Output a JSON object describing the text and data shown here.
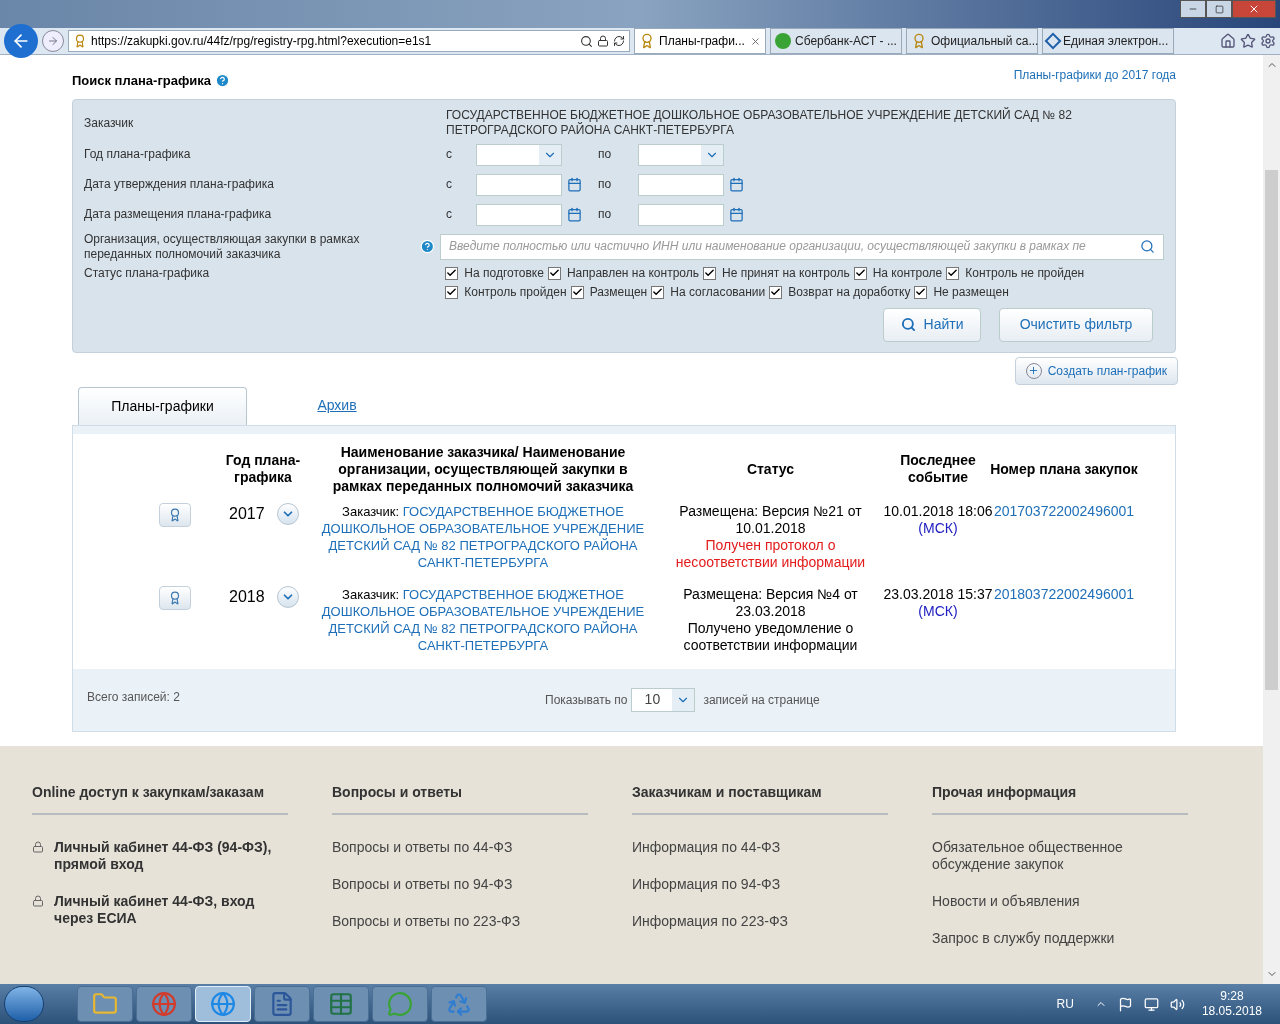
{
  "browser": {
    "url": "https://zakupki.gov.ru/44fz/rpg/registry-rpg.html?execution=e1s1",
    "tabs": [
      {
        "title": "Планы-графи...",
        "selected": true,
        "kind": "emblem"
      },
      {
        "title": "Сбербанк-АСТ - ...",
        "selected": false,
        "kind": "sber"
      },
      {
        "title": "Официальный са...",
        "selected": false,
        "kind": "emblem"
      },
      {
        "title": "Единая электрон...",
        "selected": false,
        "kind": "diamond"
      }
    ]
  },
  "search": {
    "title": "Поиск плана-графика",
    "old_link": "Планы-графики до 2017 года",
    "customer_label": "Заказчик",
    "customer_value": "ГОСУДАРСТВЕННОЕ БЮДЖЕТНОЕ ДОШКОЛЬНОЕ ОБРАЗОВАТЕЛЬНОЕ УЧРЕЖДЕНИЕ ДЕТСКИЙ САД № 82 ПЕТРОГРАДСКОГО РАЙОНА САНКТ-ПЕТЕРБУРГА",
    "ranges": [
      {
        "label": "Год плана-графика",
        "from": "с",
        "to": "по",
        "kind": "select"
      },
      {
        "label": "Дата утверждения плана-графика",
        "from": "с",
        "to": "по",
        "kind": "date"
      },
      {
        "label": "Дата размещения плана-графика",
        "from": "с",
        "to": "по",
        "kind": "date"
      }
    ],
    "org_label": "Организация, осуществляющая закупки в рамках переданных полномочий заказчика",
    "org_placeholder": "Введите полностью или частично ИНН или наименование организации, осуществляющей закупки в рамках пе",
    "status_label": "Статус плана-графика",
    "statuses": [
      {
        "label": "На подготовке",
        "checked": true
      },
      {
        "label": "Направлен на контроль",
        "checked": true
      },
      {
        "label": "Не принят на контроль",
        "checked": true
      },
      {
        "label": "На контроле",
        "checked": true
      },
      {
        "label": "Контроль не пройден",
        "checked": true
      },
      {
        "label": "Контроль пройден",
        "checked": true
      },
      {
        "label": "Размещен",
        "checked": true
      },
      {
        "label": "На согласовании",
        "checked": true
      },
      {
        "label": "Возврат на доработку",
        "checked": true
      },
      {
        "label": "Не размещен",
        "checked": true
      }
    ],
    "find_button": "Найти",
    "clear_button": "Очистить фильтр"
  },
  "create_button": "Создать план-график",
  "tabs": [
    {
      "label": "Планы-графики",
      "selected": true
    },
    {
      "label": "Архив",
      "selected": false
    }
  ],
  "table": {
    "columns": [
      "Год плана-графика",
      "Наименование заказчика/ Наименование организации, осуществляющей закупки в рамках переданных полномочий заказчика",
      "Статус",
      "Последнее событие",
      "Номер плана закупок"
    ],
    "rows": [
      {
        "year": "2017",
        "customer_prefix": "Заказчик:",
        "customer": "ГОСУДАРСТВЕННОЕ БЮДЖЕТНОЕ ДОШКОЛЬНОЕ ОБРАЗОВАТЕЛЬНОЕ УЧРЕЖДЕНИЕ ДЕТСКИЙ САД № 82 ПЕТРОГРАДСКОГО РАЙОНА САНКТ-ПЕТЕРБУРГА",
        "status": "Размещена: Версия №21 от 10.01.2018",
        "note": "Получен протокол о несоответствии информации",
        "note_alert": true,
        "event": "10.01.2018 18:06",
        "tz": "(МСК)",
        "number": "201703722002496001"
      },
      {
        "year": "2018",
        "customer_prefix": "Заказчик:",
        "customer": "ГОСУДАРСТВЕННОЕ БЮДЖЕТНОЕ ДОШКОЛЬНОЕ ОБРАЗОВАТЕЛЬНОЕ УЧРЕЖДЕНИЕ ДЕТСКИЙ САД № 82 ПЕТРОГРАДСКОГО РАЙОНА САНКТ-ПЕТЕРБУРГА",
        "status": "Размещена: Версия №4 от 23.03.2018",
        "note": "Получено уведомление о соответствии информации",
        "note_alert": false,
        "event": "23.03.2018 15:37",
        "tz": "(МСК)",
        "number": "201803722002496001"
      }
    ],
    "total": "Всего записей: 2",
    "page_size_label": "Показывать по",
    "page_size": "10",
    "page_size_suffix": "записей на странице"
  },
  "footer": [
    {
      "title": "Online доступ к закупкам/заказам",
      "kind": "locked",
      "links": [
        "Личный кабинет 44-ФЗ (94-ФЗ), прямой вход",
        "Личный кабинет 44-ФЗ, вход через ЕСИА"
      ]
    },
    {
      "title": "Вопросы и ответы",
      "kind": "plain",
      "links": [
        "Вопросы и ответы по 44-ФЗ",
        "Вопросы и ответы по 94-ФЗ",
        "Вопросы и ответы по 223-ФЗ"
      ]
    },
    {
      "title": "Заказчикам и поставщикам",
      "kind": "plain",
      "links": [
        "Информация по 44-ФЗ",
        "Информация по 94-ФЗ",
        "Информация по 223-ФЗ"
      ]
    },
    {
      "title": "Прочая информация",
      "kind": "plain",
      "links": [
        "Обязательное общественное обсуждение закупок",
        "Новости и объявления",
        "Запрос в службу поддержки"
      ]
    }
  ],
  "taskbar": {
    "apps": [
      {
        "kind": "folder",
        "selected": false
      },
      {
        "kind": "chrome",
        "selected": false
      },
      {
        "kind": "ie",
        "selected": true
      },
      {
        "kind": "word",
        "selected": false
      },
      {
        "kind": "excel",
        "selected": false
      },
      {
        "kind": "chat",
        "selected": false
      },
      {
        "kind": "recycle",
        "selected": false
      }
    ],
    "lang": "RU",
    "time": "9:28",
    "date": "18.05.2018"
  }
}
